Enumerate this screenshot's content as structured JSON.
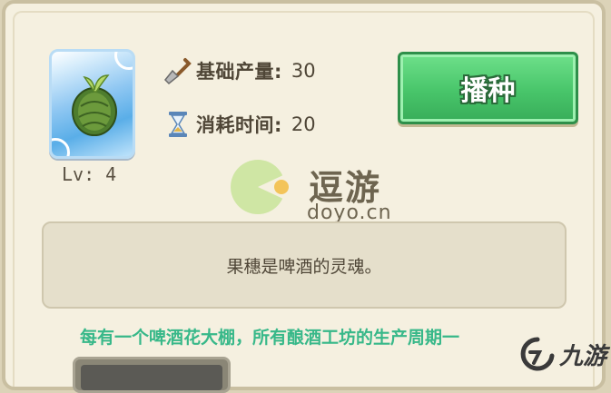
{
  "item": {
    "icon": "hop-cone-icon",
    "level_label": "Lv: 4"
  },
  "stats": {
    "base_output_label": "基础产量:",
    "base_output_value": "30",
    "base_output_icon": "shovel-icon",
    "time_label": "消耗时间:",
    "time_value": "20",
    "time_icon": "hourglass-icon"
  },
  "plant_button": {
    "label": "播种"
  },
  "description": "果穗是啤酒的灵魂。",
  "effect_text": "每有一个啤酒花大棚，所有酿酒工坊的生产周期一",
  "watermark": {
    "title": "逗游",
    "subtitle": "doyo.cn"
  },
  "corner_logo": {
    "text": "九游"
  },
  "colors": {
    "button_green": "#48c56a",
    "effect_text": "#37b889",
    "panel_bg": "#f5f0e0"
  }
}
